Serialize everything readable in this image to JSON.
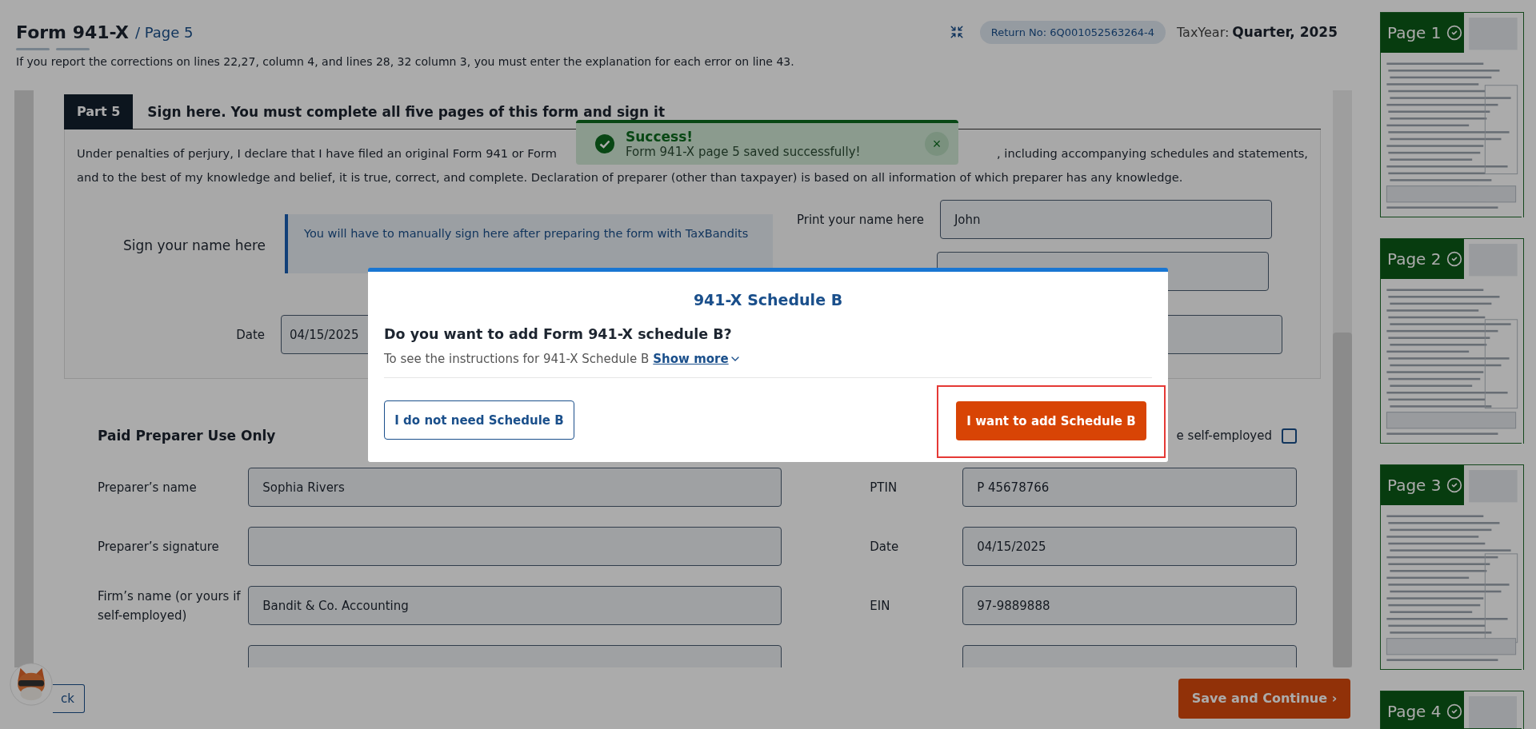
{
  "header": {
    "title": "Form 941-X",
    "page": "/ Page 5",
    "return_no": "Return No: 6Q001052563264-4",
    "tax_year_label": "TaxYear:",
    "tax_year_value": "Quarter, 2025"
  },
  "notice": "If you report the corrections on lines 22,27, column 4, and lines 28, 32 column 3, you must enter the explanation for each error on line 43.",
  "part": {
    "badge": "Part 5",
    "heading": "Sign here. You must complete all five pages of this form and sign it",
    "declaration_start": "Under penalties of perjury, I declare that I have filed an original Form 941 or Form",
    "declaration_end": ", including accompanying schedules and statements,",
    "declaration_line2": "and to the best of my knowledge and belief, it is true, correct, and complete. Declaration of preparer (other than taxpayer) is based on all information of which preparer has any knowledge."
  },
  "sign": {
    "label": "Sign your name here",
    "note": "You will have to manually sign here after preparing the form with TaxBandits",
    "print_label": "Print your name here",
    "print_value": "John",
    "date_label": "Date",
    "date_value": "04/15/2025"
  },
  "preparer": {
    "heading": "Paid Preparer Use Only",
    "self_employed_label": "e self-employed",
    "self_employed_checked": false,
    "rows": [
      {
        "left_label": "Preparer’s name",
        "left_value": "Sophia  Rivers",
        "right_label": "PTIN",
        "right_value": "P  45678766"
      },
      {
        "left_label": "Preparer’s signature",
        "right_label": "Date",
        "right_value": "04/15/2025"
      },
      {
        "left_label": "Firm’s name (or yours if self-employed)",
        "left_value": "Bandit & Co. Accounting",
        "right_label": "EIN",
        "right_value": "97-9889888"
      }
    ]
  },
  "footer": {
    "back": "ck",
    "save": "Save and Continue ›"
  },
  "toast": {
    "title": "Success!",
    "message": "Form 941-X page 5 saved successfully!",
    "close": "×"
  },
  "modal": {
    "title": "941-X Schedule B",
    "question": "Do you want to add Form 941-X schedule B?",
    "hint": "To see the instructions for 941-X Schedule B",
    "show_more": "Show more",
    "decline": "I do not need Schedule B",
    "accept": "I want to add Schedule B",
    "accept_highlighted": true
  },
  "pages": [
    {
      "label": "Page 1",
      "completed": true
    },
    {
      "label": "Page 2",
      "completed": true
    },
    {
      "label": "Page 3",
      "completed": true
    },
    {
      "label": "Page 4",
      "completed": true
    }
  ]
}
